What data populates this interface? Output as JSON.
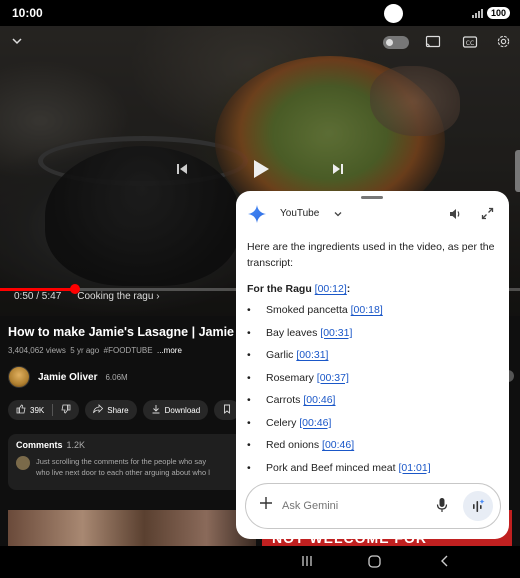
{
  "status_bar": {
    "time": "10:00",
    "battery": "100"
  },
  "video": {
    "current_time": "0:50",
    "duration": "5:47",
    "time_display": "0:50 / 5:47",
    "chapter": "Cooking the ragu",
    "progress_fraction": 0.144
  },
  "video_info": {
    "title": "How to make Jamie's Lasagne | Jamie Ol",
    "views": "3,404,062 views",
    "age": "5 yr ago",
    "hashtag": "#FOODTUBE",
    "more": "...more",
    "channel_name": "Jamie Oliver",
    "subscribers": "6.06M",
    "likes": "39K",
    "share_label": "Share",
    "download_label": "Download"
  },
  "comments": {
    "label": "Comments",
    "count": "1.2K",
    "line1": "Just scrolling the comments for the people who say",
    "line2": "who live next door to each other arguing about who l"
  },
  "thumbnail2_text": "NOT WELCOME FOR",
  "gemini": {
    "app_name": "YouTube",
    "intro": "Here are the ingredients used in the video, as per the transcript:",
    "section_title": "For the Ragu",
    "section_ts": "[00:12]",
    "section_colon": ":",
    "ingredients": [
      {
        "name": "Smoked pancetta",
        "ts": "[00:18]"
      },
      {
        "name": "Bay leaves",
        "ts": "[00:31]"
      },
      {
        "name": "Garlic",
        "ts": "[00:31]"
      },
      {
        "name": "Rosemary",
        "ts": "[00:37]"
      },
      {
        "name": "Carrots",
        "ts": "[00:46]"
      },
      {
        "name": "Celery",
        "ts": "[00:46]"
      },
      {
        "name": "Red onions",
        "ts": "[00:46]"
      },
      {
        "name": "Pork and Beef minced meat",
        "ts": "[01:01]"
      }
    ],
    "input_placeholder": "Ask Gemini"
  },
  "colors": {
    "accent_red": "#ff0000",
    "link_blue": "#1a57c8",
    "gemini_blue": "#4285f4"
  }
}
